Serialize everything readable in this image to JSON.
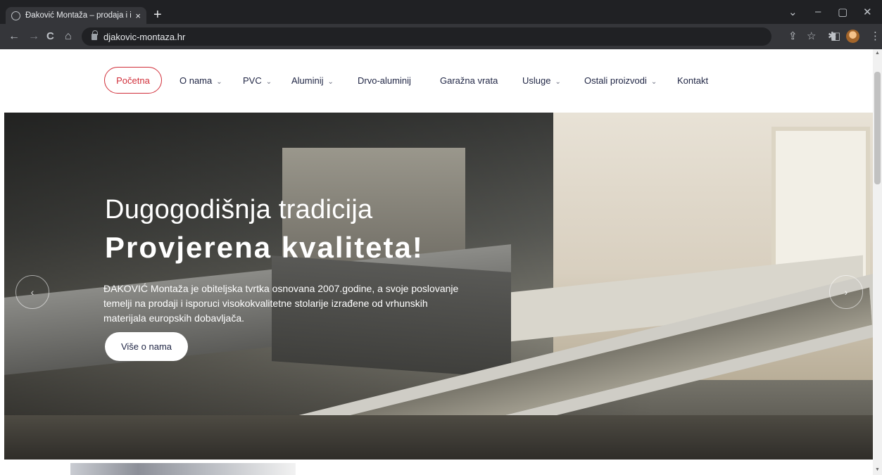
{
  "browser": {
    "tab_title": "Đaković Montaža – prodaja i isp",
    "tab_close": "×",
    "new_tab": "+",
    "url": "djakovic-montaza.hr",
    "window_controls": {
      "minimize": "–",
      "maximize": "▢",
      "close": "✕",
      "tab_search": "⌄"
    },
    "nav": {
      "back": "←",
      "forward": "→",
      "reload": "C",
      "home": "⌂"
    },
    "toolbar_icons": {
      "share": "⇪",
      "bookmark": "☆",
      "extensions": "✱",
      "sidebar": "◧",
      "menu": "⋮"
    }
  },
  "site_nav": {
    "items": [
      {
        "label": "Početna",
        "has_dropdown": false,
        "active": true
      },
      {
        "label": "O nama",
        "has_dropdown": true
      },
      {
        "label": "PVC",
        "has_dropdown": true
      },
      {
        "label": "Aluminij",
        "has_dropdown": true
      },
      {
        "label": "Drvo-aluminij",
        "has_dropdown": false
      },
      {
        "label": "Garažna vrata",
        "has_dropdown": false
      },
      {
        "label": "Usluge",
        "has_dropdown": true
      },
      {
        "label": "Ostali proizvodi",
        "has_dropdown": true
      },
      {
        "label": "Kontakt",
        "has_dropdown": false
      }
    ],
    "chevron": "⌄",
    "active_color": "#d12f3a"
  },
  "hero": {
    "subtitle": "Dugogodišnja tradicija",
    "title": "Provjerena kvaliteta!",
    "text": "ĐAKOVIĆ Montaža je obiteljska tvrtka osnovana 2007.godine, a svoje poslovanje temelji na prodaji i isporuci visokokvalitetne stolarije izrađene od vrhunskih materijala europskih dobavljača.",
    "button": "Više o nama",
    "prev_arrow": "‹",
    "next_arrow": "›"
  }
}
